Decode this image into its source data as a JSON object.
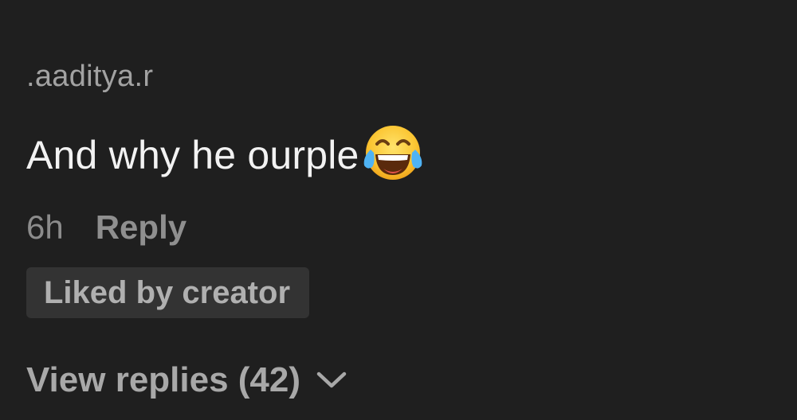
{
  "comment": {
    "username": ".aaditya.r",
    "text": "And why he ourple",
    "emoji_icon": "face-with-tears-of-joy-icon",
    "timestamp": "6h",
    "reply_label": "Reply",
    "badge_label": "Liked by creator",
    "view_replies_label": "View replies (42)",
    "view_replies_icon": "chevron-down-icon"
  },
  "colors": {
    "background": "#1f1f1f",
    "username": "#a2a2a2",
    "comment_text": "#f2f2f2",
    "meta_text": "#8c8c8c",
    "badge_background": "#333333",
    "badge_text": "#b0b0b0"
  }
}
